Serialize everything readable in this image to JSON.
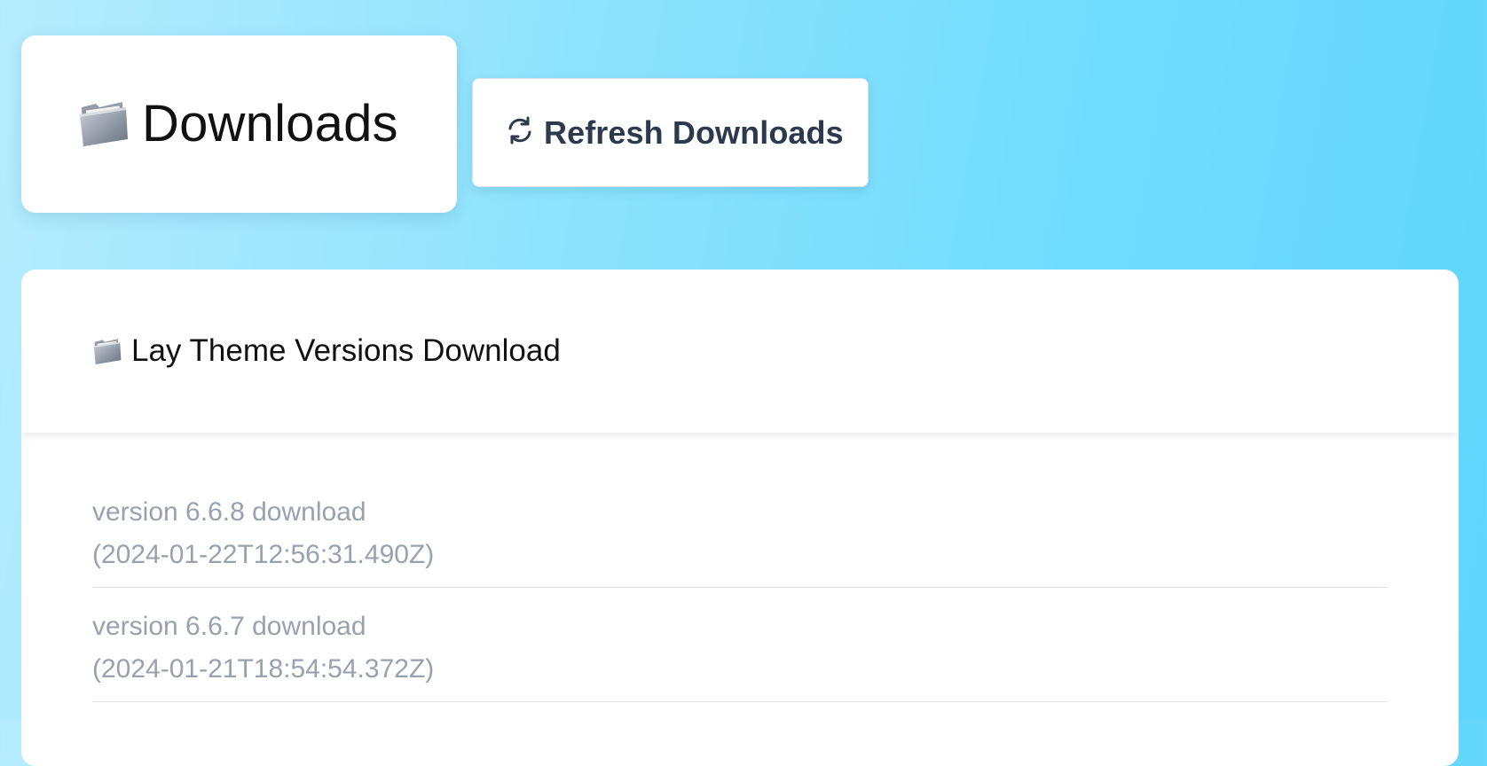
{
  "header": {
    "title": "Downloads",
    "icon": "folder-icon"
  },
  "toolbar": {
    "refresh_label": "Refresh Downloads",
    "refresh_icon": "refresh-icon"
  },
  "card": {
    "title": "Lay Theme Versions Download",
    "icon": "folder-icon"
  },
  "versions": [
    {
      "label": "version 6.6.8 download",
      "timestamp": "(2024-01-22T12:56:31.490Z)"
    },
    {
      "label": "version 6.6.7 download",
      "timestamp": "(2024-01-21T18:54:54.372Z)"
    }
  ],
  "colors": {
    "background_start": "#b6ecfd",
    "background_end": "#5fd6fc",
    "button_text": "#2d3a4d",
    "muted_text": "#98a1ae"
  }
}
